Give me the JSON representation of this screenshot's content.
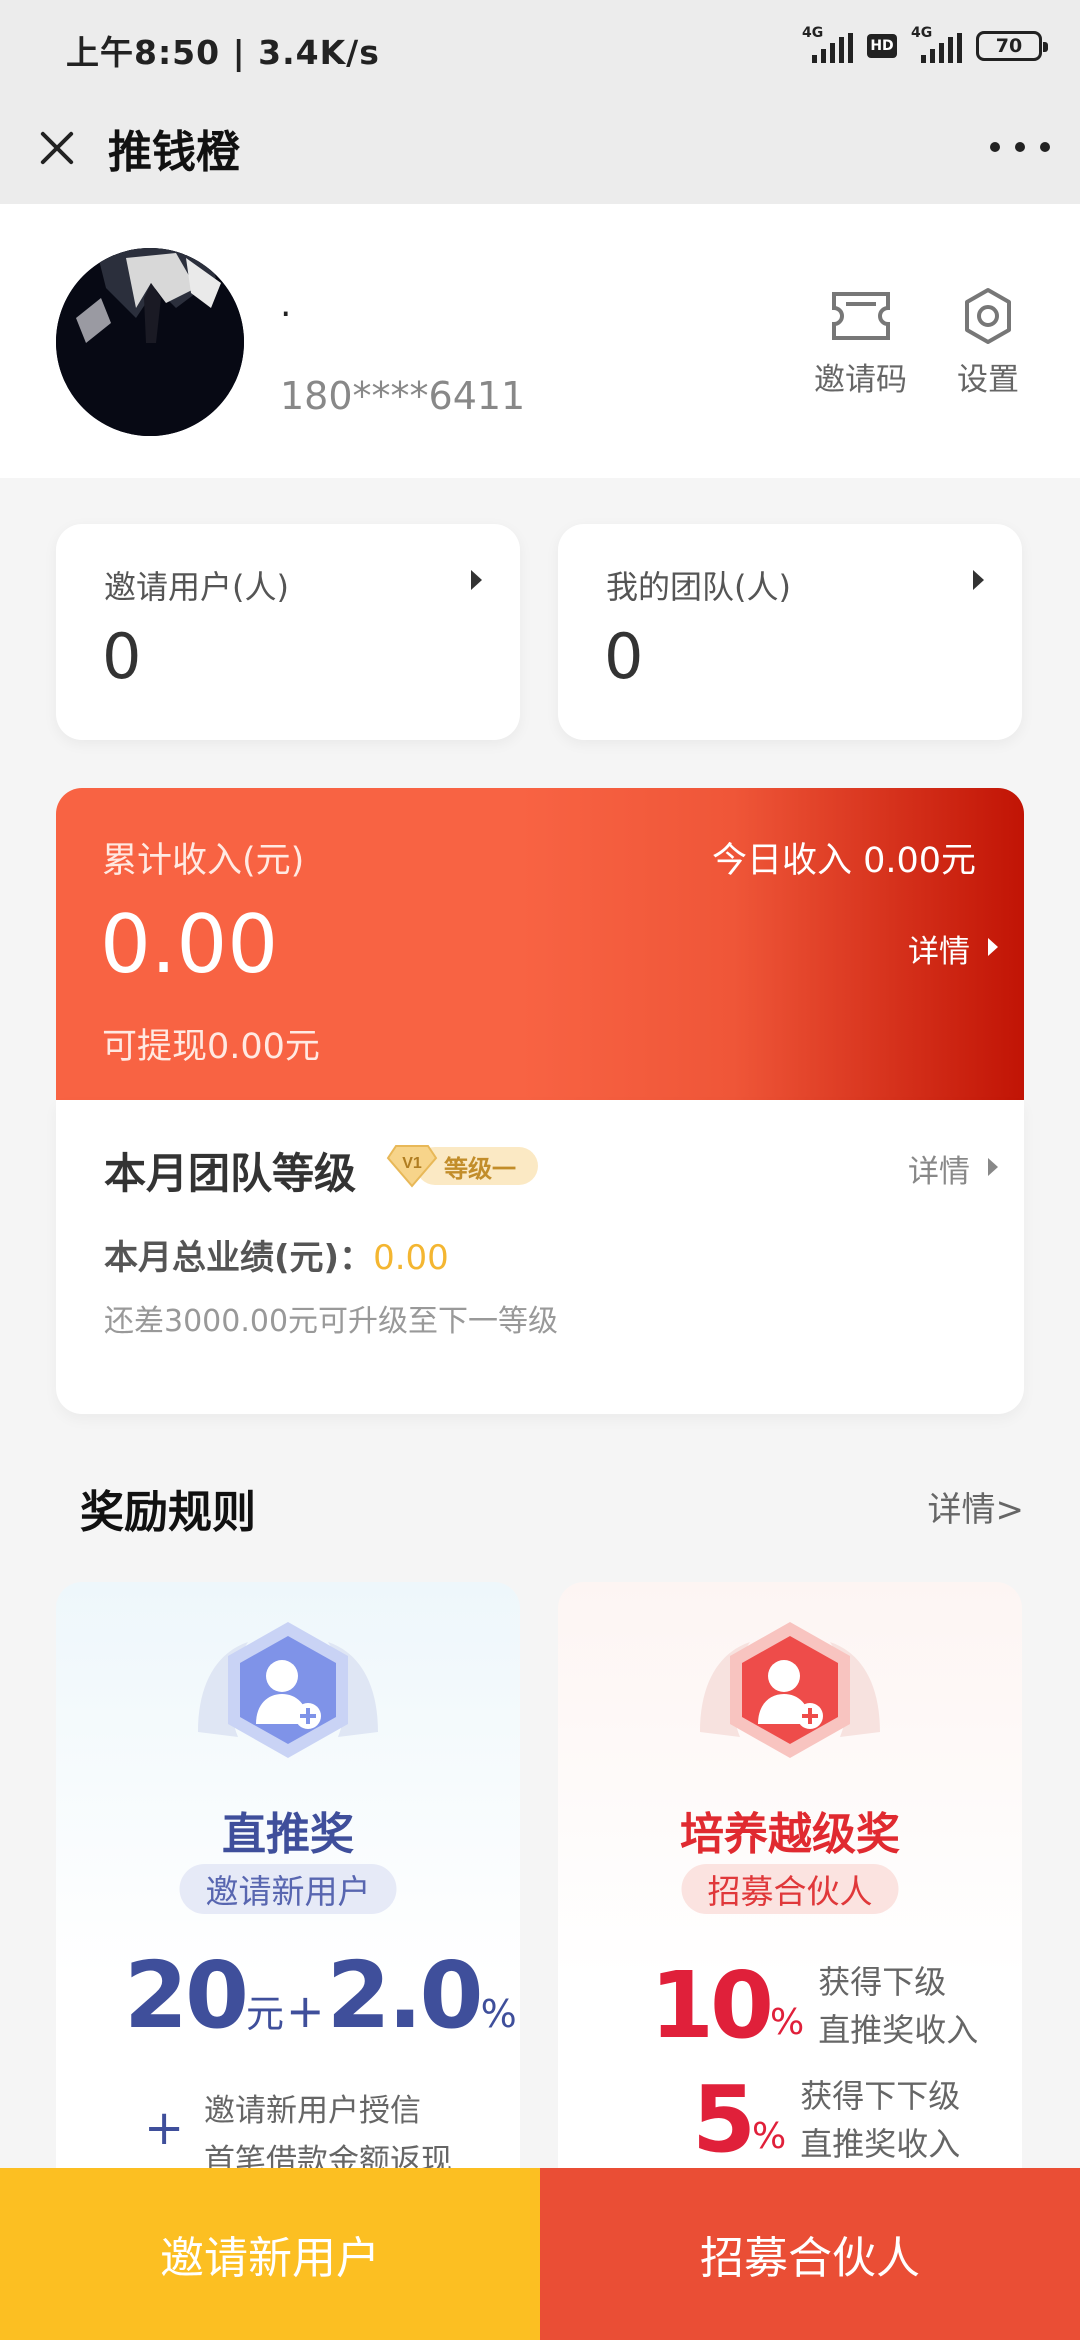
{
  "status_bar": {
    "time": "上午8:50 | 3.4K/s",
    "signal1_label": "4G",
    "hd_label": "HD",
    "signal2_label": "4G",
    "battery": "70"
  },
  "nav": {
    "title": "推钱橙"
  },
  "profile": {
    "nickname": "·",
    "phone": "180****6411",
    "invite_code_label": "邀请码",
    "settings_label": "设置"
  },
  "stats": [
    {
      "label": "邀请用户(人)",
      "value": "0"
    },
    {
      "label": "我的团队(人)",
      "value": "0"
    }
  ],
  "income": {
    "total_label": "累计收入(元)",
    "today": "今日收入 0.00元",
    "total_value": "0.00",
    "detail_label": "详情",
    "withdrawable": "可提现0.00元"
  },
  "team_level": {
    "title": "本月团队等级",
    "badge_icon_text": "V1",
    "badge_text": "等级一",
    "detail_label": "详情",
    "performance_label": "本月总业绩(元)：",
    "performance_value": "0.00",
    "hint": "还差3000.00元可升级至下一等级"
  },
  "rules": {
    "title": "奖励规则",
    "more_label": "详情>",
    "cards": [
      {
        "name": "直推奖",
        "subtitle": "邀请新用户",
        "amount": "20",
        "amount_unit": "元",
        "plus": "+",
        "percent": "2.0",
        "percent_unit": "%",
        "desc_plus": "+",
        "desc_line1": "邀请新用户授信",
        "desc_line2": "首笔借款金额返现"
      },
      {
        "name": "培养越级奖",
        "subtitle": "招募合伙人",
        "rows": [
          {
            "num": "10",
            "unit": "%",
            "line1": "获得下级",
            "line2": "直推奖收入"
          },
          {
            "num": "5",
            "unit": "%",
            "line1": "获得下下级",
            "line2": "直推奖收入"
          }
        ]
      }
    ]
  },
  "bottom": {
    "invite_label": "邀请新用户",
    "recruit_label": "招募合伙人"
  },
  "colors": {
    "accent_orange": "#f86343",
    "accent_red": "#c11405",
    "invite_button": "#fcbf22",
    "recruit_button": "#ea4e35",
    "blue_text": "#3f4f9b",
    "red_text": "#e0203a"
  }
}
